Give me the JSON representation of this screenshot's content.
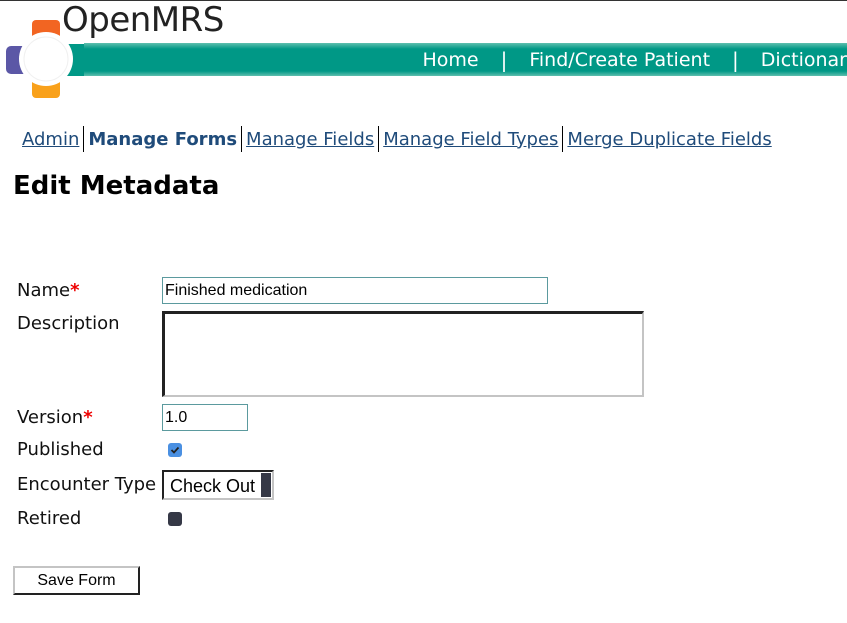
{
  "header": {
    "brand": "OpenMRS",
    "nav": [
      {
        "label": "Home"
      },
      {
        "label": "Find/Create Patient"
      },
      {
        "label": "Dictionar"
      }
    ],
    "colors": {
      "navbar": "#009886",
      "logo_orange": "#f26522",
      "logo_purple": "#5b57a6",
      "logo_teal": "#009886",
      "logo_yellow": "#f9a11b"
    }
  },
  "subnav": {
    "items": [
      {
        "label": "Admin",
        "active": false
      },
      {
        "label": "Manage Forms",
        "active": true
      },
      {
        "label": "Manage Fields",
        "active": false
      },
      {
        "label": "Manage Field Types",
        "active": false
      },
      {
        "label": "Merge Duplicate Fields",
        "active": false
      }
    ]
  },
  "page": {
    "title": "Edit Metadata"
  },
  "form": {
    "name": {
      "label": "Name",
      "required_mark": "*",
      "value": "Finished medication"
    },
    "description": {
      "label": "Description",
      "value": ""
    },
    "version": {
      "label": "Version",
      "required_mark": "*",
      "value": "1.0"
    },
    "published": {
      "label": "Published",
      "checked": true
    },
    "encounter_type": {
      "label": "Encounter Type",
      "selected": "Check Out"
    },
    "retired": {
      "label": "Retired",
      "checked": false
    },
    "save_label": "Save Form"
  }
}
